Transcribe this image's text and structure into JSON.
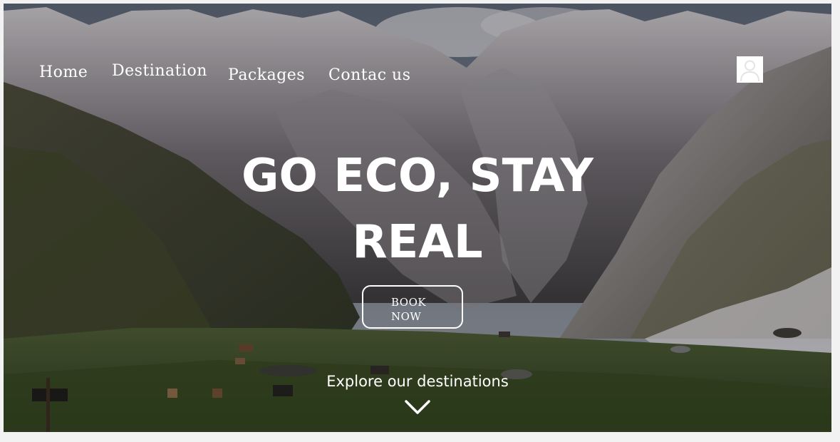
{
  "nav": {
    "items": [
      {
        "label": "Home"
      },
      {
        "label": "Destination"
      },
      {
        "label": "Packages"
      },
      {
        "label": "Contac us"
      }
    ],
    "profile_icon": "user-icon"
  },
  "hero": {
    "headline_line1": "GO ECO, STAY",
    "headline_line2": "REAL",
    "cta_label_line1": "BOOK",
    "cta_label_line2": "NOW",
    "explore_label": "Explore our destinations",
    "scroll_icon": "chevron-down-icon",
    "background": "mountain-valley-photo"
  },
  "colors": {
    "text": "#ffffff",
    "page_bg": "#f2f2f2"
  }
}
